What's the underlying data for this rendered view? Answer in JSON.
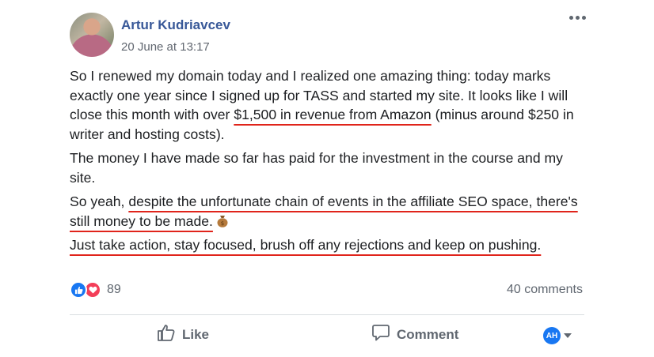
{
  "post": {
    "author": "Artur Kudriavcev",
    "timestamp": "20 June at 13:17",
    "paragraphs": {
      "p1_a": "So I renewed my domain today and I realized one amazing thing: today marks exactly one year since I signed up for TASS and started my site. It looks like I will close this month with over ",
      "p1_highlight": "$1,500 in revenue from Amazon",
      "p1_b": " (minus around $250 in writer and hosting costs).",
      "p2": "The money I have made so far has paid for the investment in the course and my site.",
      "p3_a": "So yeah, ",
      "p3_highlight": "despite the unfortunate chain of events in the affiliate SEO space, there's still money to be made.",
      "p4": "Just take action, stay focused, brush off any rejections and keep on pushing."
    },
    "emoji": "money-bag-icon"
  },
  "footer": {
    "reaction_count": "89",
    "comments": "40 comments",
    "like_label": "Like",
    "comment_label": "Comment",
    "share_avatar_initials": "AH"
  },
  "colors": {
    "author_link": "#385898",
    "highlight_underline": "#e0241b",
    "like_blue": "#1877f2",
    "love_red": "#f33e58"
  }
}
